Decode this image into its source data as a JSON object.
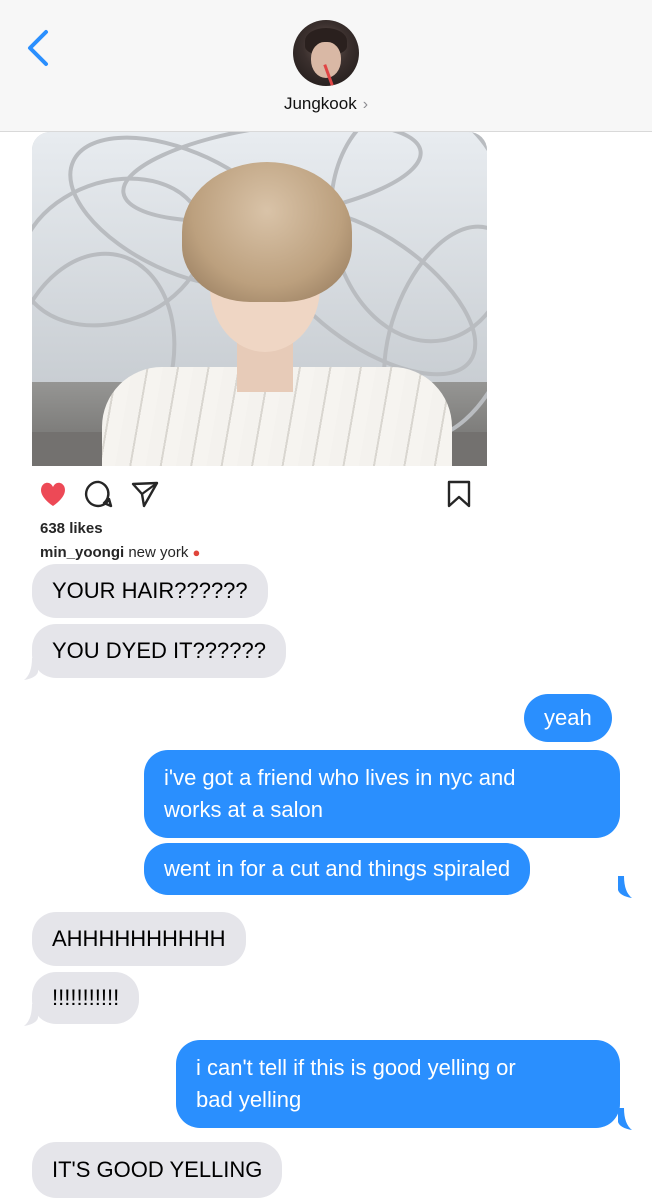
{
  "header": {
    "back_icon": "chevron-left-icon",
    "contact_name": "Jungkook",
    "chevron": "›",
    "accent_color": "#2a8ffe"
  },
  "shared_post": {
    "likes": "638 likes",
    "username": "min_yoongi",
    "location": "new york",
    "icons": [
      "heart-icon",
      "comment-icon",
      "share-icon",
      "bookmark-icon"
    ],
    "liked": true
  },
  "messages": [
    {
      "from": "them",
      "text": "YOUR HAIR??????"
    },
    {
      "from": "them",
      "text": "YOU DYED IT??????"
    },
    {
      "from": "me",
      "text": "yeah"
    },
    {
      "from": "me",
      "lines": [
        "i've got a friend who lives in nyc and",
        "works at a salon"
      ]
    },
    {
      "from": "me",
      "text": "went in for a cut and things spiraled"
    },
    {
      "from": "them",
      "text": "AHHHHHHHHHH"
    },
    {
      "from": "them",
      "text": "!!!!!!!!!!!"
    },
    {
      "from": "me",
      "lines": [
        "i can't tell if this is good yelling or",
        "bad yelling"
      ]
    },
    {
      "from": "them",
      "text": "IT'S GOOD YELLING"
    }
  ],
  "colors": {
    "incoming_bubble": "#e5e5ea",
    "outgoing_bubble": "#2a8ffe",
    "heart": "#ed4956"
  }
}
